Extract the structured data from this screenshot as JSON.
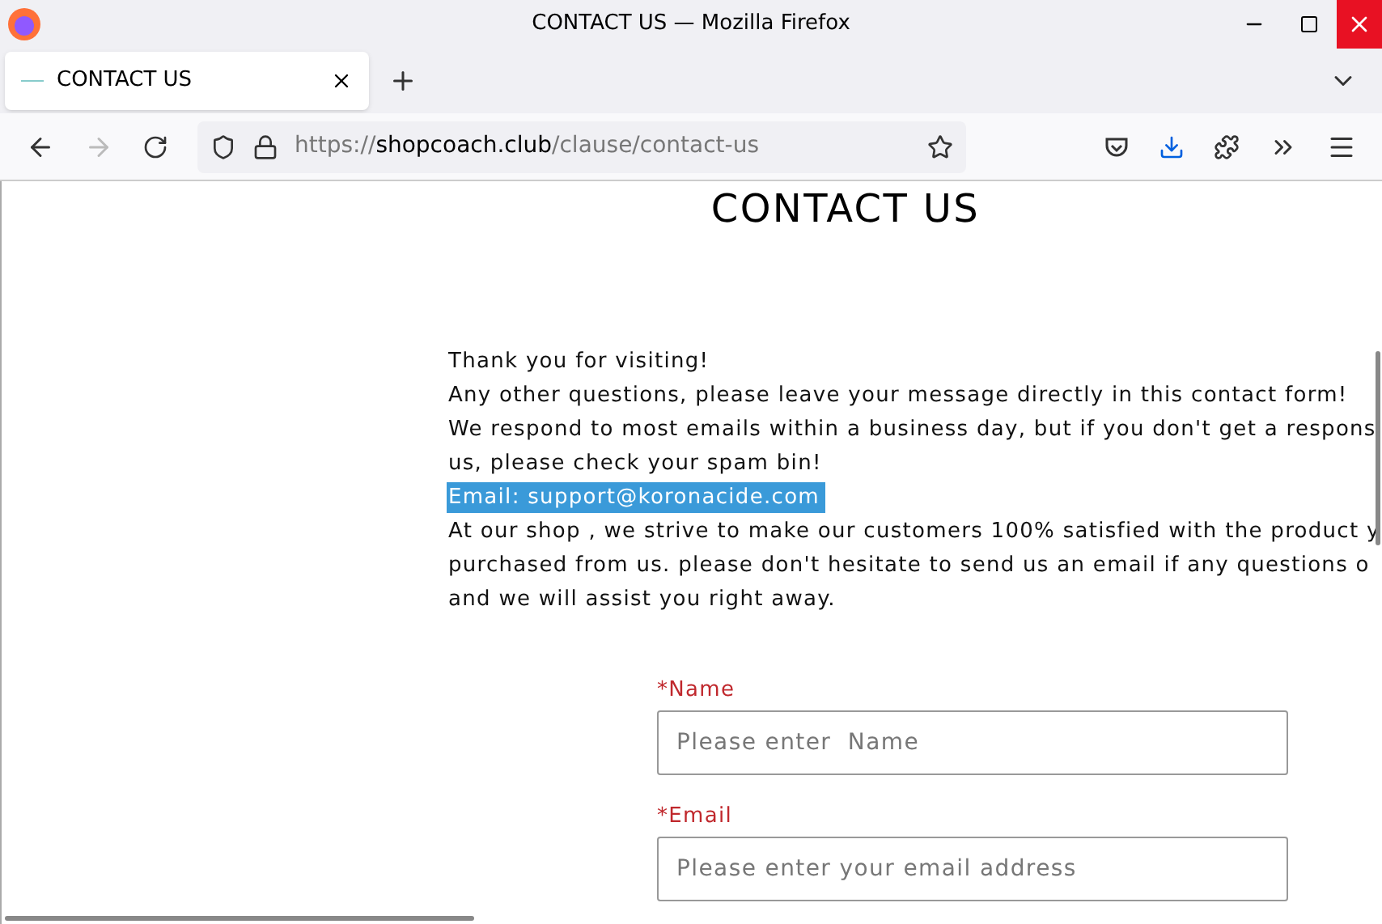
{
  "window": {
    "title": "CONTACT US — Mozilla Firefox"
  },
  "tabs": [
    {
      "label": "CONTACT US",
      "selected": true
    }
  ],
  "toolbar": {
    "forward_disabled": true
  },
  "address_bar": {
    "scheme": "https://",
    "domain": "shopcoach.club",
    "path": "/clause/contact-us"
  },
  "page": {
    "heading": "CONTACT US",
    "lines": [
      {
        "text": "Thank you for visiting!",
        "highlighted": false
      },
      {
        "text": "Any other questions, please leave your message directly in this contact form!",
        "highlighted": false
      },
      {
        "text": "We respond to most emails within a business day, but if you don't get a respons",
        "highlighted": false
      },
      {
        "text": "us, please check your spam bin!",
        "highlighted": false
      },
      {
        "text": "Email: support@koronacide.com",
        "highlighted": true
      },
      {
        "text": "At our shop , we strive to make our customers 100% satisfied with the product y",
        "highlighted": false
      },
      {
        "text": "purchased from us. please don't hesitate to send us an email if any questions o",
        "highlighted": false
      },
      {
        "text": "and we will assist you right away.",
        "highlighted": false
      }
    ],
    "form": {
      "fields": [
        {
          "label": "*Name",
          "placeholder": "Please enter  Name"
        },
        {
          "label": "*Email",
          "placeholder": "Please enter your email address"
        }
      ]
    }
  }
}
